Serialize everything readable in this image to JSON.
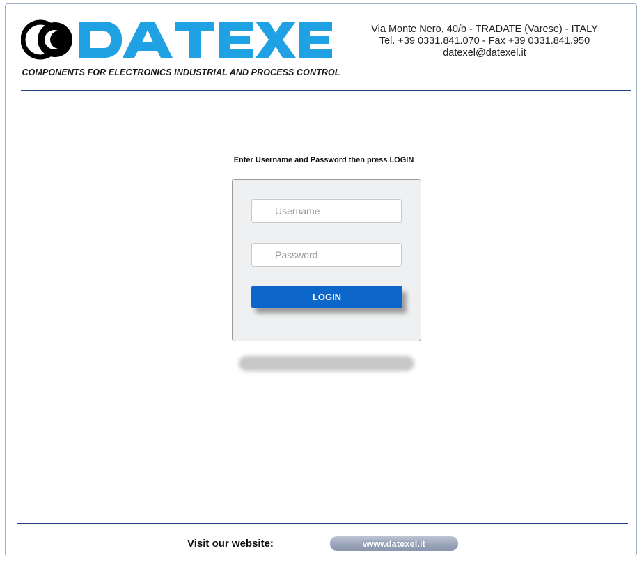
{
  "header": {
    "brand": "DATEXEL",
    "tagline": "COMPONENTS FOR ELECTRONICS INDUSTRIAL AND PROCESS CONTROL",
    "address_line1": "Via Monte Nero, 40/b - TRADATE (Varese) - ITALY",
    "address_line2": "Tel. +39 0331.841.070 - Fax +39 0331.841.950",
    "address_line3": "datexel@datexel.it"
  },
  "login": {
    "instructions": "Enter Username and Password then press LOGIN",
    "username_placeholder": "Username",
    "password_placeholder": "Password",
    "login_label": "LOGIN"
  },
  "footer": {
    "visit_label": "Visit our website:",
    "website_link": "www.datexel.it"
  },
  "colors": {
    "brand_blue": "#1fa1e3",
    "rule_navy": "#1f3f86",
    "button_blue": "#0d66c9"
  }
}
